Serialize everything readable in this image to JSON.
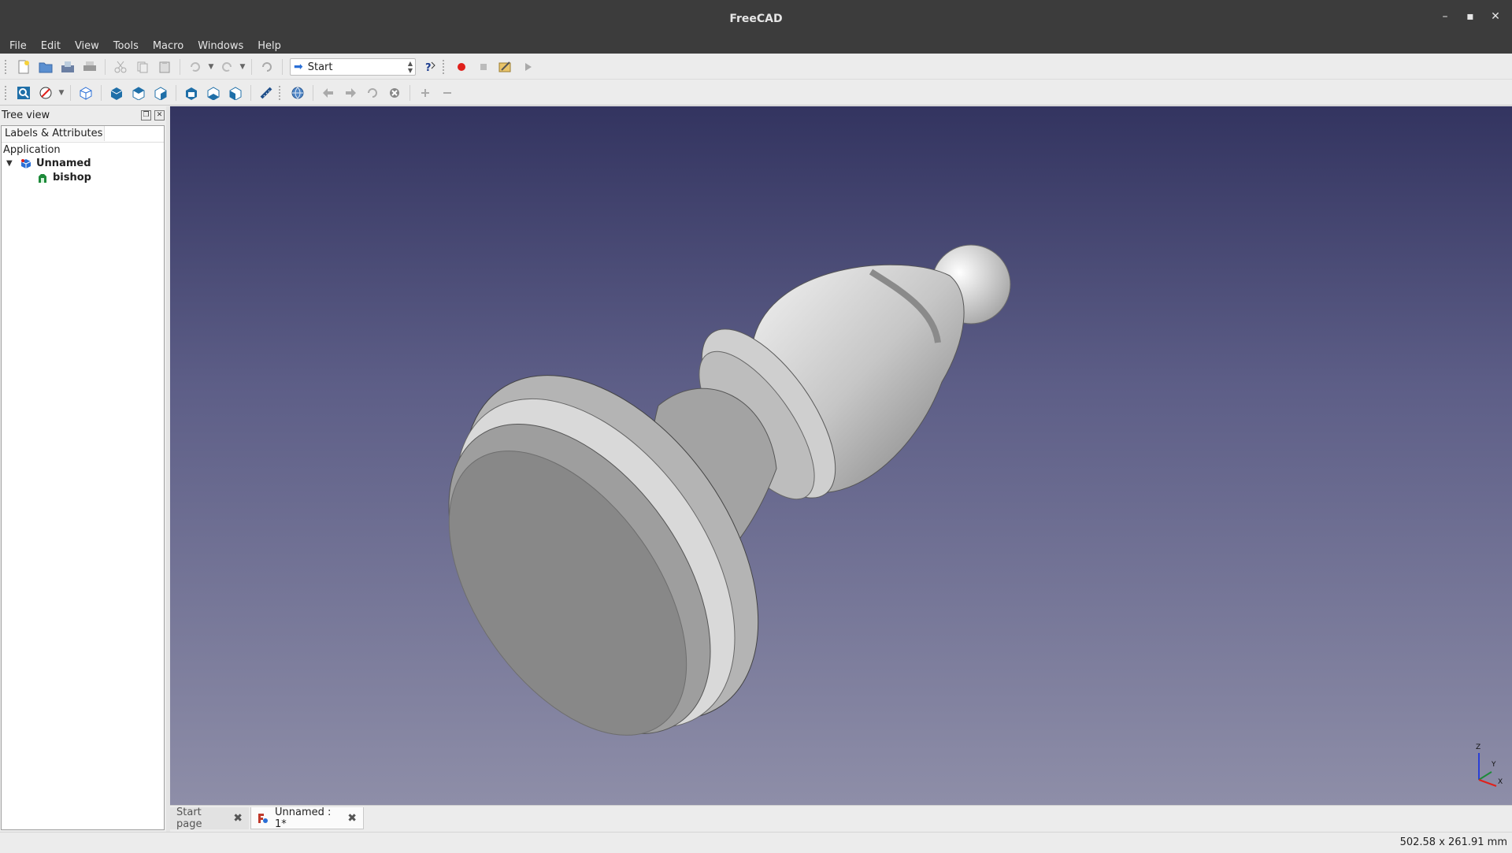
{
  "window": {
    "title": "FreeCAD"
  },
  "menu": [
    {
      "label": "File"
    },
    {
      "label": "Edit"
    },
    {
      "label": "View"
    },
    {
      "label": "Tools"
    },
    {
      "label": "Macro"
    },
    {
      "label": "Windows"
    },
    {
      "label": "Help"
    }
  ],
  "toolbar": {
    "workbench": "Start"
  },
  "panel": {
    "title": "Tree view",
    "column_header": "Labels & Attributes",
    "section": "Application",
    "document": "Unnamed",
    "object": "bishop"
  },
  "axis": {
    "z": "Z",
    "y": "Y",
    "x": "X"
  },
  "tabs": [
    {
      "label": "Start page"
    },
    {
      "label": "Unnamed : 1*"
    }
  ],
  "status": {
    "dimensions": "502.58 x 261.91 mm"
  },
  "colors": {
    "viewport_top": "#333460",
    "viewport_bottom": "#8e8ea8",
    "record": "#e0201b",
    "accent": "#2a6fd6"
  }
}
